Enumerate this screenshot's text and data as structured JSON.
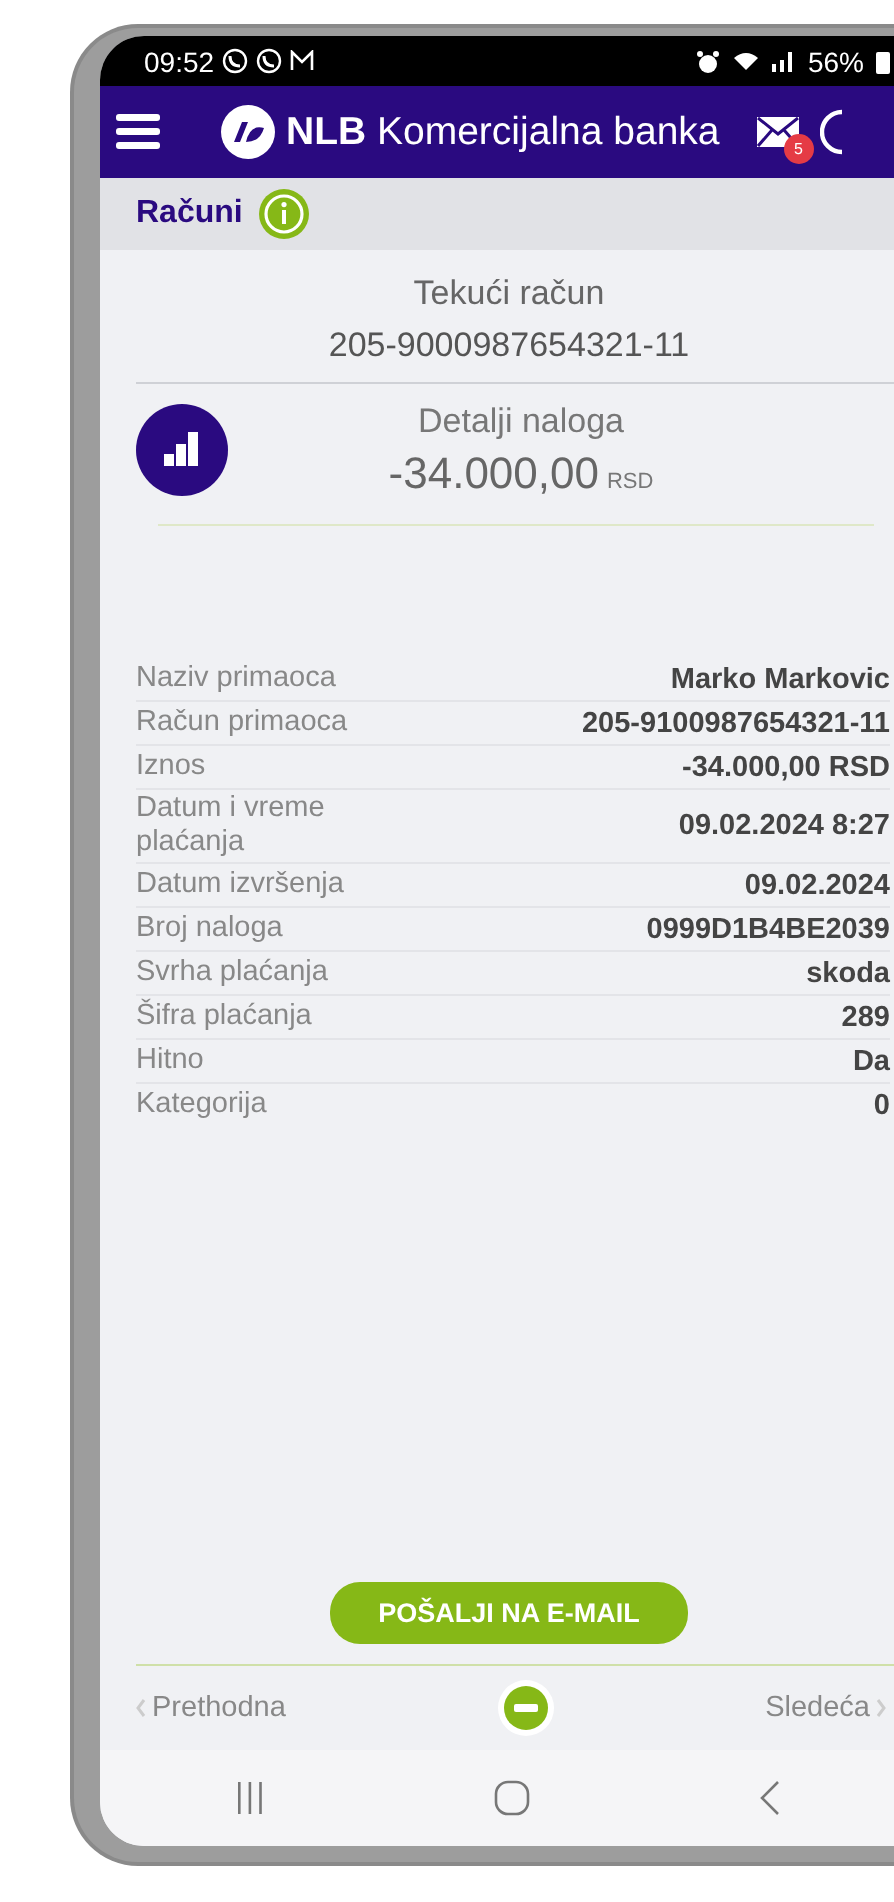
{
  "status_bar": {
    "time": "09:52",
    "battery": "56%"
  },
  "header": {
    "title": "**NLB** Komercijalna banka",
    "badge": "5"
  },
  "subheader": {
    "title": "Računi"
  },
  "account": {
    "type": "Tekući račun",
    "number": "205-9000987654321-11"
  },
  "order": {
    "title": "Detalji naloga",
    "amount": "-34.000,00",
    "currency": "RSD"
  },
  "details": [
    {
      "label": "Naziv primaoca",
      "value": "Marko Markovic"
    },
    {
      "label": "Račun primaoca",
      "value": "205-9100987654321-11"
    },
    {
      "label": "Iznos",
      "value": "-34.000,00 RSD"
    },
    {
      "label": "Datum i vreme plaćanja",
      "value": "09.02.2024 8:27"
    },
    {
      "label": "Datum izvršenja",
      "value": "09.02.2024"
    },
    {
      "label": "Broj naloga",
      "value": "0999D1B4BE2039"
    },
    {
      "label": "Svrha plaćanja",
      "value": "skoda"
    },
    {
      "label": "Šifra plaćanja",
      "value": "289"
    },
    {
      "label": "Hitno",
      "value": "Da"
    },
    {
      "label": "Kategorija",
      "value": "0"
    }
  ],
  "email_button": "POŠALJI NA E-MAIL",
  "pager": {
    "previous": "Prethodna",
    "next": "Sledeća"
  }
}
